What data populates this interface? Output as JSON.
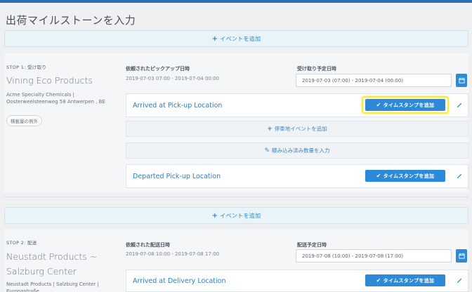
{
  "page": {
    "title": "出荷マイルストーンを入力"
  },
  "add_event": {
    "plus": "+",
    "label": "イベントを追加"
  },
  "stops": [
    {
      "label": "STOP 1: 受け取り",
      "name": "Vining Eco Products",
      "address": "Acme Specialty Chemicals | Oosterweelsteenweg 58 Antwerpen , BE",
      "tag": "積載量の例外",
      "requested_label": "依頼されたピックアップ日時",
      "requested_value": "2019-07-03 07:00 - 2019-07-04 00:00",
      "scheduled_label": "受け取り予定日時",
      "scheduled_value": "2019-07-03 (07:00) - 2019-07-04 (00:00)",
      "events": [
        {
          "label": "Arrived at Pick-up Location",
          "button": "タイムスタンプを追加",
          "highlighted": true
        },
        {
          "label": "Departed Pick-up Location",
          "button": "タイムスタンプを追加",
          "highlighted": false
        }
      ],
      "sub_actions": [
        {
          "icon": "+",
          "label": "停車地イベントを追加"
        },
        {
          "icon": "✎",
          "label": "積み込み済み数量を入力"
        }
      ]
    },
    {
      "label": "STOP 2: 配送",
      "name": "Neustadt Products ~ Salzburg Center",
      "address": "Neustadt Products | Salzburg Center | Europastraße",
      "requested_label": "依頼された配送日時",
      "requested_value": "2019-07-08 10:00 - 2019-07-08 17:00",
      "scheduled_label": "配送予定日時",
      "scheduled_value": "2019-07-08 (10:00) - 2019-07-08 (17:00)",
      "events": [
        {
          "label": "Arrived at Delivery Location",
          "button": "タイムスタンプを追加",
          "highlighted": false
        }
      ]
    }
  ],
  "icons": {
    "calendar": "calendar-icon",
    "check": "✔",
    "pin": "pin-icon"
  },
  "colors": {
    "primary": "#2c8ad9",
    "link": "#2f7cc4",
    "highlight": "#f3ee3a"
  }
}
